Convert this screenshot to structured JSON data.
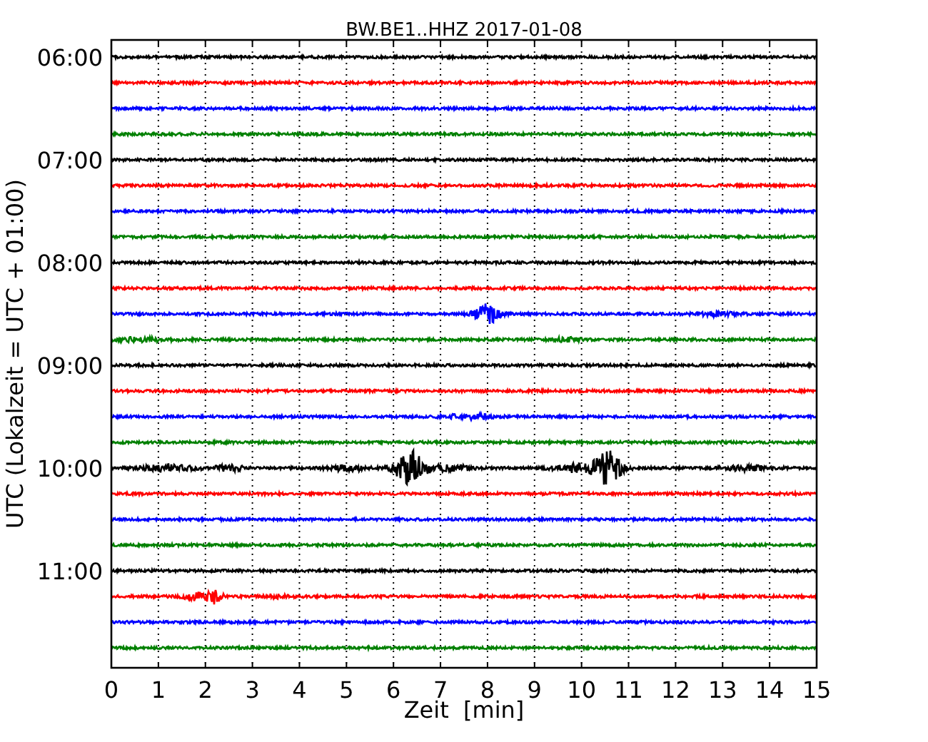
{
  "title": "BW.BE1..HHZ 2017-01-08",
  "ylabel": "UTC (Lokalzeit = UTC + 01:00)",
  "xlabel": "Zeit  [min]",
  "yticks": [
    "06:00",
    "07:00",
    "08:00",
    "09:00",
    "10:00",
    "11:00"
  ],
  "xticks": [
    "0",
    "1",
    "2",
    "3",
    "4",
    "5",
    "6",
    "7",
    "8",
    "9",
    "10",
    "11",
    "12",
    "13",
    "14",
    "15"
  ],
  "traces": [
    {
      "color": "#000000"
    },
    {
      "color": "#ff0000"
    },
    {
      "color": "#0000ff"
    },
    {
      "color": "#008000"
    },
    {
      "color": "#000000"
    },
    {
      "color": "#ff0000"
    },
    {
      "color": "#0000ff"
    },
    {
      "color": "#008000"
    },
    {
      "color": "#000000"
    },
    {
      "color": "#ff0000"
    },
    {
      "color": "#0000ff"
    },
    {
      "color": "#008000"
    },
    {
      "color": "#000000"
    },
    {
      "color": "#ff0000"
    },
    {
      "color": "#0000ff"
    },
    {
      "color": "#008000"
    },
    {
      "color": "#000000"
    },
    {
      "color": "#ff0000"
    },
    {
      "color": "#0000ff"
    },
    {
      "color": "#008000"
    },
    {
      "color": "#000000"
    },
    {
      "color": "#ff0000"
    },
    {
      "color": "#0000ff"
    },
    {
      "color": "#008000"
    }
  ]
}
